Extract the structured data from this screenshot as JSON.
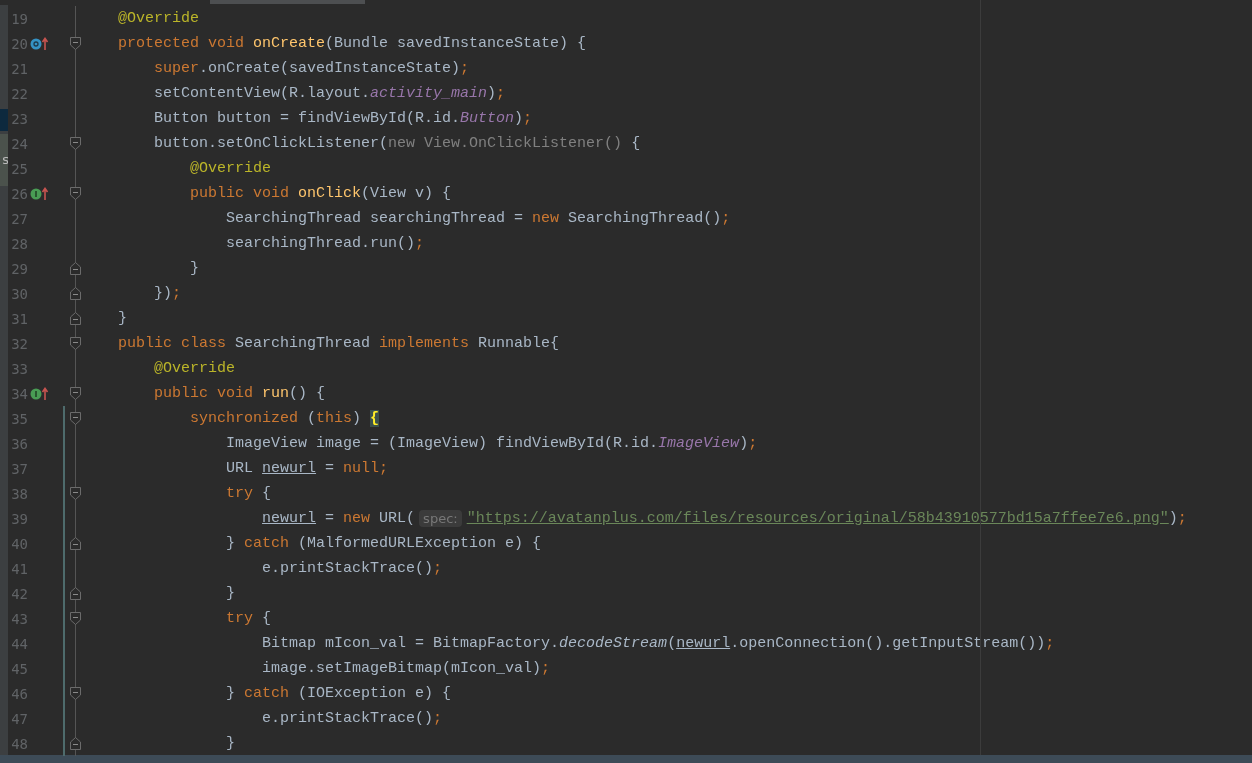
{
  "left_strip": {
    "tabs": [
      {
        "selected": true
      },
      {
        "label": "s",
        "selected": false
      }
    ]
  },
  "lines": [
    {
      "number": "19",
      "modified": false,
      "tokens": [
        {
          "text": "@Override",
          "kind": "annotation"
        }
      ]
    },
    {
      "number": "20",
      "modified": false,
      "gutter_icon": {
        "kind": "override"
      },
      "fold_marker": {
        "kind": "start"
      },
      "tokens": [
        {
          "text": "protected void ",
          "kind": "keyword"
        },
        {
          "text": "onCreate",
          "kind": "method"
        },
        {
          "text": "(Bundle savedInstanceState) {",
          "kind": "plain"
        }
      ]
    },
    {
      "number": "21",
      "modified": false,
      "tokens": [
        {
          "text": "    super",
          "kind": "keyword"
        },
        {
          "text": ".onCreate(savedInstanceState)",
          "kind": "plain"
        },
        {
          "text": ";",
          "kind": "keyword"
        }
      ]
    },
    {
      "number": "22",
      "modified": false,
      "tokens": [
        {
          "text": "    setContentView(R.layout.",
          "kind": "plain"
        },
        {
          "text": "activity_main",
          "kind": "field"
        },
        {
          "text": ")",
          "kind": "plain"
        },
        {
          "text": ";",
          "kind": "keyword"
        }
      ]
    },
    {
      "number": "23",
      "modified": false,
      "tokens": [
        {
          "text": "    Button button = findViewById(R.id.",
          "kind": "plain"
        },
        {
          "text": "Button",
          "kind": "field"
        },
        {
          "text": ")",
          "kind": "plain"
        },
        {
          "text": ";",
          "kind": "keyword"
        }
      ]
    },
    {
      "number": "24",
      "modified": false,
      "fold_marker": {
        "kind": "start"
      },
      "tokens": [
        {
          "text": "    button.setOnClickListener(",
          "kind": "plain"
        },
        {
          "text": "new View.OnClickListener()",
          "kind": "folded"
        },
        {
          "text": " {",
          "kind": "plain"
        }
      ]
    },
    {
      "number": "25",
      "modified": false,
      "tokens": [
        {
          "text": "        @Override",
          "kind": "annotation"
        }
      ]
    },
    {
      "number": "26",
      "modified": false,
      "gutter_icon": {
        "kind": "implement"
      },
      "fold_marker": {
        "kind": "start"
      },
      "tokens": [
        {
          "text": "        public void ",
          "kind": "keyword"
        },
        {
          "text": "onClick",
          "kind": "method"
        },
        {
          "text": "(View v) {",
          "kind": "plain"
        }
      ]
    },
    {
      "number": "27",
      "modified": false,
      "tokens": [
        {
          "text": "            SearchingThread searchingThread = ",
          "kind": "plain"
        },
        {
          "text": "new ",
          "kind": "keyword"
        },
        {
          "text": "SearchingThread()",
          "kind": "plain"
        },
        {
          "text": ";",
          "kind": "keyword"
        }
      ]
    },
    {
      "number": "28",
      "modified": false,
      "tokens": [
        {
          "text": "            searchingThread.run()",
          "kind": "plain"
        },
        {
          "text": ";",
          "kind": "keyword"
        }
      ]
    },
    {
      "number": "29",
      "modified": false,
      "fold_marker": {
        "kind": "end"
      },
      "tokens": [
        {
          "text": "        }",
          "kind": "plain"
        }
      ]
    },
    {
      "number": "30",
      "modified": false,
      "fold_marker": {
        "kind": "end"
      },
      "tokens": [
        {
          "text": "    })",
          "kind": "plain"
        },
        {
          "text": ";",
          "kind": "keyword"
        }
      ]
    },
    {
      "number": "31",
      "modified": false,
      "fold_marker": {
        "kind": "end"
      },
      "tokens": [
        {
          "text": "}",
          "kind": "plain"
        }
      ]
    },
    {
      "number": "32",
      "modified": false,
      "fold_marker": {
        "kind": "start"
      },
      "tokens": [
        {
          "text": "public class ",
          "kind": "keyword"
        },
        {
          "text": "SearchingThread ",
          "kind": "plain"
        },
        {
          "text": "implements ",
          "kind": "keyword"
        },
        {
          "text": "Runnable{",
          "kind": "plain"
        }
      ]
    },
    {
      "number": "33",
      "modified": false,
      "tokens": [
        {
          "text": "    @Override",
          "kind": "annotation"
        }
      ]
    },
    {
      "number": "34",
      "modified": false,
      "gutter_icon": {
        "kind": "implement"
      },
      "fold_marker": {
        "kind": "start"
      },
      "tokens": [
        {
          "text": "    public void ",
          "kind": "keyword"
        },
        {
          "text": "run",
          "kind": "method"
        },
        {
          "text": "() {",
          "kind": "plain"
        }
      ]
    },
    {
      "number": "35",
      "modified": true,
      "fold_marker": {
        "kind": "start"
      },
      "tokens": [
        {
          "text": "        synchronized ",
          "kind": "keyword"
        },
        {
          "text": "(",
          "kind": "plain"
        },
        {
          "text": "this",
          "kind": "keyword"
        },
        {
          "text": ") ",
          "kind": "plain"
        },
        {
          "text": "{",
          "kind": "brace_match"
        }
      ]
    },
    {
      "number": "36",
      "modified": true,
      "tokens": [
        {
          "text": "            ImageView image = (ImageView) findViewById(R.id.",
          "kind": "plain"
        },
        {
          "text": "ImageView",
          "kind": "field"
        },
        {
          "text": ")",
          "kind": "plain"
        },
        {
          "text": ";",
          "kind": "keyword"
        }
      ]
    },
    {
      "number": "37",
      "modified": true,
      "tokens": [
        {
          "text": "            URL ",
          "kind": "plain"
        },
        {
          "text": "newurl",
          "kind": "reassigned"
        },
        {
          "text": " = ",
          "kind": "plain"
        },
        {
          "text": "null",
          "kind": "keyword"
        },
        {
          "text": ";",
          "kind": "keyword"
        }
      ]
    },
    {
      "number": "38",
      "modified": true,
      "fold_marker": {
        "kind": "start"
      },
      "tokens": [
        {
          "text": "            try ",
          "kind": "keyword"
        },
        {
          "text": "{",
          "kind": "plain"
        }
      ]
    },
    {
      "number": "39",
      "modified": true,
      "tokens": [
        {
          "text": "                newurl",
          "kind": "reassigned"
        },
        {
          "text": " = ",
          "kind": "plain"
        },
        {
          "text": "new ",
          "kind": "keyword"
        },
        {
          "text": "URL(",
          "kind": "plain"
        },
        {
          "text": "spec:",
          "kind": "hint"
        },
        {
          "text": "\"https://avatanplus.com/files/resources/original/58b43910577bd15a7ffee7e6.png\"",
          "kind": "url_string"
        },
        {
          "text": ")",
          "kind": "plain"
        },
        {
          "text": ";",
          "kind": "keyword"
        }
      ]
    },
    {
      "number": "40",
      "modified": true,
      "fold_marker": {
        "kind": "end"
      },
      "tokens": [
        {
          "text": "            } ",
          "kind": "plain"
        },
        {
          "text": "catch ",
          "kind": "keyword"
        },
        {
          "text": "(MalformedURLException e) {",
          "kind": "plain"
        }
      ]
    },
    {
      "number": "41",
      "modified": true,
      "tokens": [
        {
          "text": "                e.printStackTrace()",
          "kind": "plain"
        },
        {
          "text": ";",
          "kind": "keyword"
        }
      ]
    },
    {
      "number": "42",
      "modified": true,
      "fold_marker": {
        "kind": "end"
      },
      "tokens": [
        {
          "text": "            }",
          "kind": "plain"
        }
      ]
    },
    {
      "number": "43",
      "modified": true,
      "fold_marker": {
        "kind": "start"
      },
      "tokens": [
        {
          "text": "            try ",
          "kind": "keyword"
        },
        {
          "text": "{",
          "kind": "plain"
        }
      ]
    },
    {
      "number": "44",
      "modified": true,
      "tokens": [
        {
          "text": "                Bitmap mIcon_val = BitmapFactory.",
          "kind": "plain"
        },
        {
          "text": "decodeStream",
          "kind": "static"
        },
        {
          "text": "(",
          "kind": "plain"
        },
        {
          "text": "newurl",
          "kind": "reassigned"
        },
        {
          "text": ".openConnection().getInputStream())",
          "kind": "plain"
        },
        {
          "text": ";",
          "kind": "keyword"
        }
      ]
    },
    {
      "number": "45",
      "modified": true,
      "tokens": [
        {
          "text": "                image.setImageBitmap(mIcon_val)",
          "kind": "plain"
        },
        {
          "text": ";",
          "kind": "keyword"
        }
      ]
    },
    {
      "number": "46",
      "modified": true,
      "fold_marker": {
        "kind": "start"
      },
      "tokens": [
        {
          "text": "            } ",
          "kind": "plain"
        },
        {
          "text": "catch ",
          "kind": "keyword"
        },
        {
          "text": "(IOException e) {",
          "kind": "plain"
        }
      ]
    },
    {
      "number": "47",
      "modified": true,
      "tokens": [
        {
          "text": "                e.printStackTrace()",
          "kind": "plain"
        },
        {
          "text": ";",
          "kind": "keyword"
        }
      ]
    },
    {
      "number": "48",
      "modified": true,
      "fold_marker": {
        "kind": "end"
      },
      "tokens": [
        {
          "text": "            }",
          "kind": "plain"
        }
      ]
    }
  ]
}
